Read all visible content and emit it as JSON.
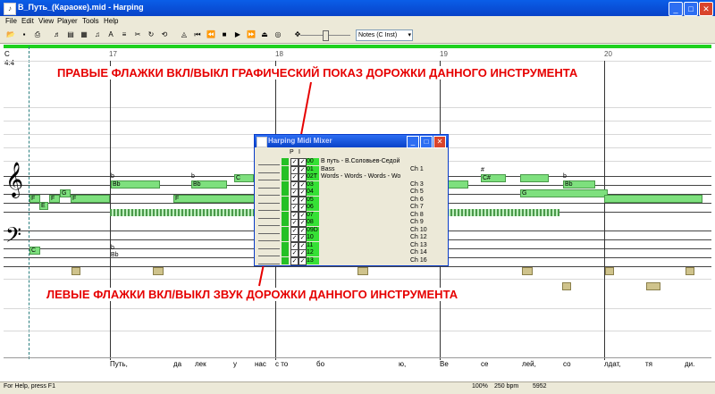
{
  "window": {
    "title": "В_Путь_(Караоке).mid - Harping",
    "minimize": "_",
    "maximize": "□",
    "close": "✕"
  },
  "menu": [
    "File",
    "Edit",
    "View",
    "Player",
    "Tools",
    "Help"
  ],
  "toolbar": {
    "tools": [
      "open-icon",
      "save-icon",
      "print-icon",
      "piano-icon",
      "keyboard-icon",
      "grid-icon",
      "score-icon",
      "text-icon",
      "chord-icon",
      "cut-icon",
      "loop-icon",
      "repeat-icon",
      "metronome-icon",
      "skip-start-icon",
      "rewind-icon",
      "stop-icon",
      "play-icon",
      "forward-icon",
      "eject-icon",
      "cd-icon",
      "settings-icon"
    ],
    "view_value": "Notes (C Inst)"
  },
  "score": {
    "key": "C",
    "time": "4:4",
    "measures": [
      "17",
      "18",
      "19",
      "20"
    ],
    "treble_clef": "𝄞",
    "bass_clef": "𝄢",
    "notes": [
      "b",
      "Bb",
      "b",
      "Bb",
      "C",
      "#",
      "C#",
      "b",
      "Bb",
      "G",
      "F",
      "E",
      "F",
      "G",
      "F",
      "F",
      "C",
      "b",
      "Bb",
      "G"
    ],
    "lyrics": [
      "Путь,",
      "да",
      "лек",
      "у",
      "нас",
      "с то",
      "бо",
      "ю,",
      "Ве",
      "се",
      "лей,",
      "со",
      "лдат,",
      "тя",
      "ди."
    ]
  },
  "annotations": {
    "top": "ПРАВЫЕ ФЛАЖКИ ВКЛ/ВЫКЛ ГРАФИЧЕСКИЙ ПОКАЗ ДОРОЖКИ ДАННОГО ИНСТРУМЕНТА",
    "bottom": "ЛЕВЫЕ ФЛАЖКИ ВКЛ/ВЫКЛ ЗВУК ДОРОЖКИ ДАННОГО ИНСТРУМЕНТА"
  },
  "mixer": {
    "title": "Harping Midi Mixer",
    "header": [
      "P",
      "I"
    ],
    "tracks": [
      {
        "num": "00",
        "name": "В путь - В.Соловьев-Седой",
        "ch": ""
      },
      {
        "num": "01",
        "name": "Bass",
        "ch": "Ch 1"
      },
      {
        "num": "02T",
        "name": "Words - Words - Words - Wo",
        "ch": ""
      },
      {
        "num": "03",
        "name": "",
        "ch": "Ch 3"
      },
      {
        "num": "04",
        "name": "",
        "ch": "Ch 5"
      },
      {
        "num": "05",
        "name": "",
        "ch": "Ch 6"
      },
      {
        "num": "06",
        "name": "",
        "ch": "Ch 7"
      },
      {
        "num": "07",
        "name": "",
        "ch": "Ch 8"
      },
      {
        "num": "08",
        "name": "",
        "ch": "Ch 9"
      },
      {
        "num": "09D",
        "name": "",
        "ch": "Ch 10"
      },
      {
        "num": "10",
        "name": "",
        "ch": "Ch 12"
      },
      {
        "num": "11",
        "name": "",
        "ch": "Ch 13"
      },
      {
        "num": "12",
        "name": "",
        "ch": "Ch 14"
      },
      {
        "num": "13",
        "name": "",
        "ch": "Ch 16"
      }
    ]
  },
  "status": {
    "help": "For Help, press F1",
    "zoom": "100%",
    "tempo": "250 bpm",
    "position": "5952"
  },
  "colors": {
    "annotation": "#e60000",
    "note_green": "#7ee07e",
    "note_tan": "#cfc38c",
    "ruler": "#1ed11e"
  }
}
